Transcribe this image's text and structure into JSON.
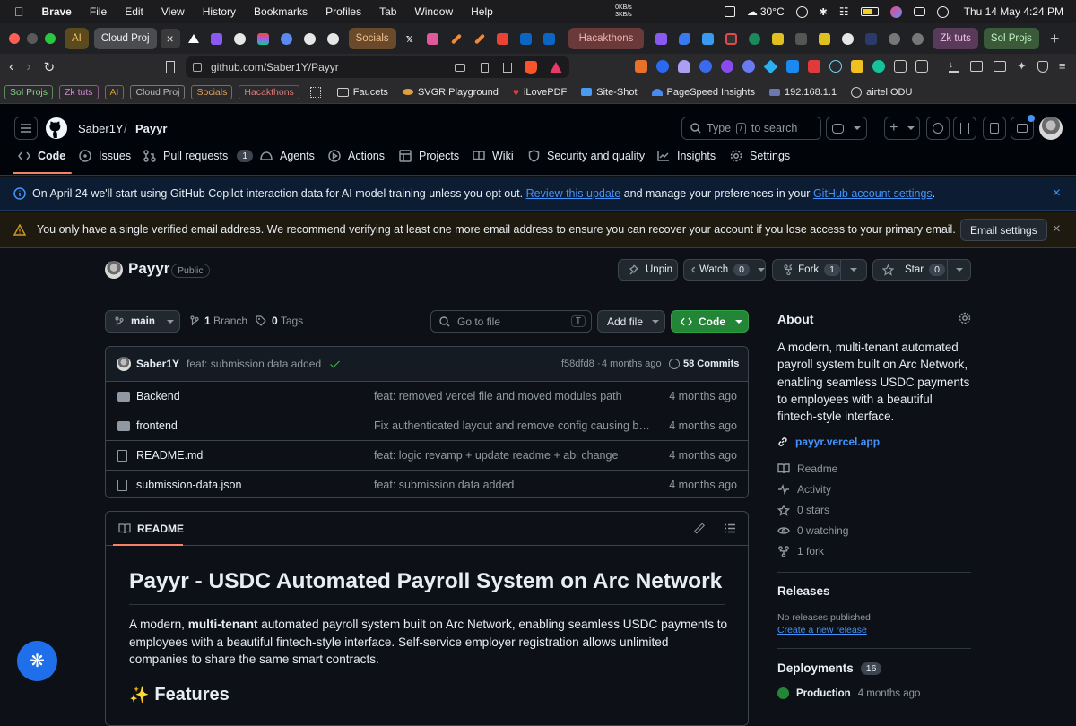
{
  "menubar": {
    "app": "Brave",
    "items": [
      "File",
      "Edit",
      "View",
      "History",
      "Bookmarks",
      "Profiles",
      "Tab",
      "Window",
      "Help"
    ],
    "net_up": "0KB/s",
    "net_down": "3KB/s",
    "weather": "30°C",
    "datetime": "Thu 14 May  4:24 PM"
  },
  "tabs": {
    "groups": [
      {
        "label": "AI",
        "color": "#d49a2a",
        "bg": "#5a4a1e"
      },
      {
        "label": "Cloud Proj",
        "color": "#9aa0a6",
        "bg": "#4a4c50"
      },
      {
        "label": "Socials",
        "color": "#e0a060",
        "bg": "#6a4a2a"
      },
      {
        "label": "Hacakthons",
        "color": "#e07a7a",
        "bg": "#6a3a3a"
      },
      {
        "label": "Zk tuts",
        "color": "#d18ad1",
        "bg": "#5a3a5a"
      },
      {
        "label": "Sol Projs",
        "color": "#8acf8a",
        "bg": "#3a5a3a"
      }
    ],
    "new_tab": "+"
  },
  "address": {
    "url": "github.com/Saber1Y/Payyr"
  },
  "bookmarks": {
    "chips": [
      {
        "label": "Sol Projs",
        "color": "#8acf8a"
      },
      {
        "label": "Zk tuts",
        "color": "#d18ad1"
      },
      {
        "label": "AI",
        "color": "#d49a2a"
      },
      {
        "label": "Cloud Proj",
        "color": "#9aa0a6"
      },
      {
        "label": "Socials",
        "color": "#e0a060"
      },
      {
        "label": "Hacakthons",
        "color": "#e07a7a"
      }
    ],
    "items": [
      "Faucets",
      "SVGR Playground",
      "iLovePDF",
      "Site-Shot",
      "PageSpeed Insights",
      "192.168.1.1",
      "airtel ODU"
    ]
  },
  "gh": {
    "owner": "Saber1Y",
    "sep": "/",
    "repo": "Payyr",
    "search_text": "Type",
    "search_key": "/",
    "search_rest": "to search",
    "nav": [
      {
        "label": "Code",
        "active": true
      },
      {
        "label": "Issues"
      },
      {
        "label": "Pull requests",
        "count": "1"
      },
      {
        "label": "Agents"
      },
      {
        "label": "Actions"
      },
      {
        "label": "Projects"
      },
      {
        "label": "Wiki"
      },
      {
        "label": "Security and quality"
      },
      {
        "label": "Insights"
      },
      {
        "label": "Settings"
      }
    ]
  },
  "banner1": {
    "pre": "On April 24 we'll start using GitHub Copilot interaction data for AI model training unless you opt out. ",
    "link1": "Review this update",
    "mid": " and manage your preferences in your ",
    "link2": "GitHub account settings",
    "post": "."
  },
  "banner2": {
    "text": "You only have a single verified email address. We recommend verifying at least one more email address to ensure you can recover your account if you lose access to your primary email.",
    "button": "Email settings"
  },
  "repo": {
    "name": "Payyr",
    "visibility": "Public",
    "unpin": "Unpin",
    "watch": "Watch",
    "watch_count": "0",
    "fork": "Fork",
    "fork_count": "1",
    "star": "Star",
    "star_count": "0"
  },
  "toolbar": {
    "branch": "main",
    "branches_n": "1",
    "branches_label": "Branch",
    "tags_n": "0",
    "tags_label": "Tags",
    "goto_placeholder": "Go to file",
    "goto_key": "T",
    "add_file": "Add file",
    "code": "Code"
  },
  "commit": {
    "author": "Saber1Y",
    "message": "feat: submission data added",
    "hash": "f58dfd8",
    "sep": "·",
    "age": "4 months ago",
    "count": "58 Commits"
  },
  "files": [
    {
      "name": "Backend",
      "type": "dir",
      "msg": "feat: removed vercel file and moved modules path",
      "date": "4 months ago"
    },
    {
      "name": "frontend",
      "type": "dir",
      "msg": "Fix authenticated layout and remove config causing build issues",
      "date": "4 months ago"
    },
    {
      "name": "README.md",
      "type": "file",
      "msg": "feat: logic revamp + update readme + abi change",
      "date": "4 months ago"
    },
    {
      "name": "submission-data.json",
      "type": "file",
      "msg": "feat: submission data added",
      "date": "4 months ago"
    }
  ],
  "readme": {
    "tab": "README",
    "title": "Payyr - USDC Automated Payroll System on Arc Network",
    "p_pre": "A modern, ",
    "p_bold": "multi-tenant",
    "p_post": " automated payroll system built on Arc Network, enabling seamless USDC payments to employees with a beautiful fintech-style interface. Self-service employer registration allows unlimited companies to share the same smart contracts.",
    "features": "Features"
  },
  "about": {
    "heading": "About",
    "desc": "A modern, multi-tenant automated payroll system built on Arc Network, enabling seamless USDC payments to employees with a beautiful fintech-style interface.",
    "link": "payyr.vercel.app",
    "items": [
      {
        "label": "Readme",
        "icon": "book-icon"
      },
      {
        "label": "Activity",
        "icon": "pulse-icon"
      },
      {
        "label": "0 stars",
        "icon": "star-icon"
      },
      {
        "label": "0 watching",
        "icon": "eye-icon"
      },
      {
        "label": "1 fork",
        "icon": "fork-icon"
      }
    ]
  },
  "releases": {
    "heading": "Releases",
    "none": "No releases published",
    "create": "Create a new release"
  },
  "deployments": {
    "heading": "Deployments",
    "count": "16",
    "first": "Production",
    "first_age": "4 months ago"
  },
  "colors": {
    "green": "#238636",
    "accent": "#4493f8",
    "underline": "#f78166"
  }
}
